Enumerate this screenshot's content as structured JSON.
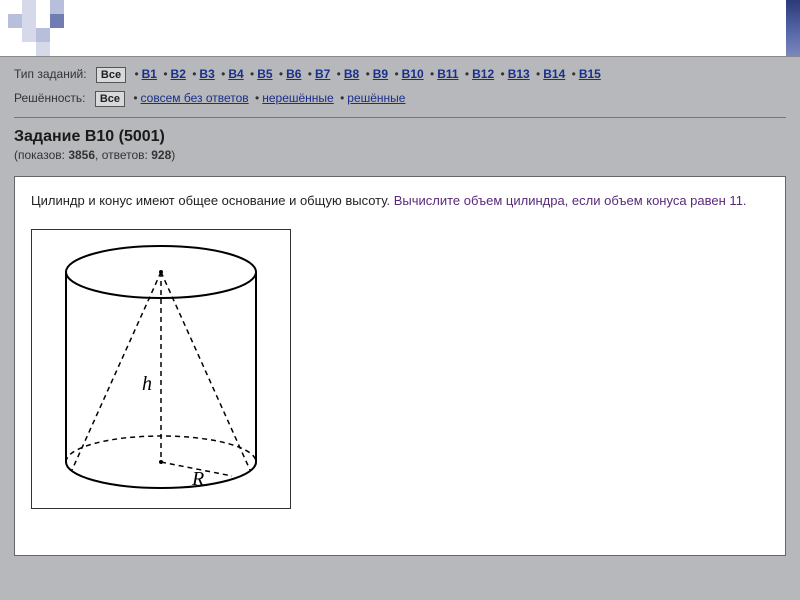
{
  "filters": {
    "type_label": "Тип заданий:",
    "all": "Все",
    "items": [
      "B1",
      "B2",
      "B3",
      "B4",
      "B5",
      "B6",
      "B7",
      "B8",
      "B9",
      "B10",
      "B11",
      "B12",
      "B13",
      "B14",
      "B15"
    ],
    "solved_label": "Решённость:",
    "solved_options": [
      "совсем без ответов",
      "нерешённые",
      "решённые"
    ]
  },
  "task": {
    "title": "Задание B10 (5001)",
    "views_label": "(показов:",
    "views": "3856",
    "answers_label": ", ответов:",
    "answers": "928",
    "close": ")"
  },
  "problem": {
    "text_part1": "Цилиндр и конус имеют общее основание и общую высоту",
    "text_part2": ". Вычислите объем цилиндра, если объем конуса равен 11.",
    "h_label": "h",
    "r_label": "R"
  }
}
